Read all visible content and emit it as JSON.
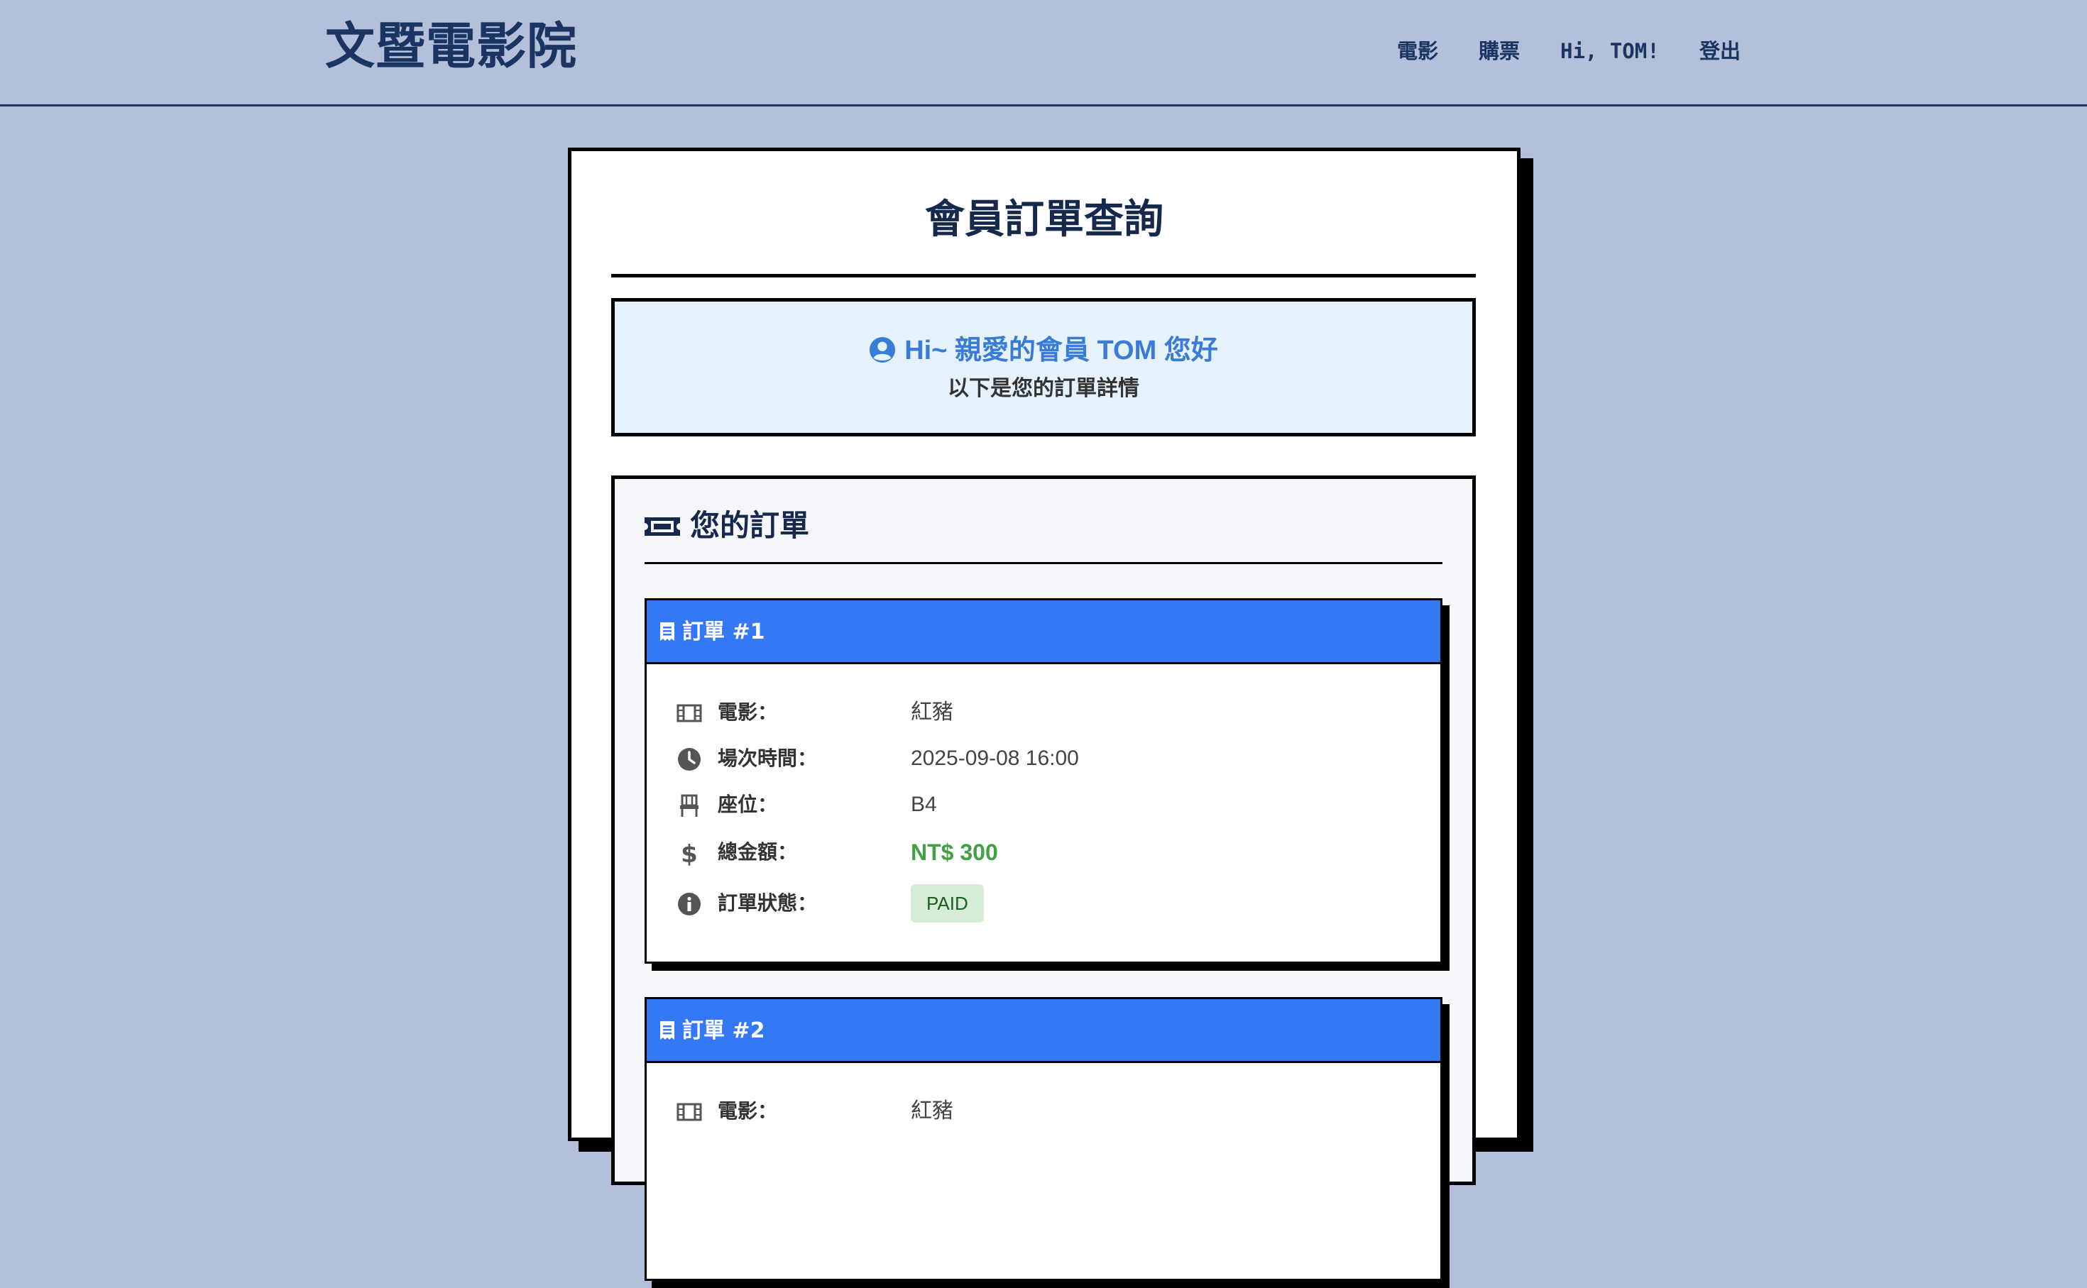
{
  "header": {
    "brand": "文暨電影院",
    "nav": {
      "movies": "電影",
      "tickets": "購票",
      "greeting": "Hi, TOM!",
      "logout": "登出"
    }
  },
  "page": {
    "title": "會員訂單查詢",
    "welcome": {
      "greeting": "Hi~ 親愛的會員 TOM 您好",
      "subtitle": "以下是您的訂單詳情"
    },
    "orders_heading": "您的訂單"
  },
  "labels": {
    "movie": "電影：",
    "showtime": "場次時間：",
    "seat": "座位：",
    "total": "總金額：",
    "status": "訂單狀態："
  },
  "orders": [
    {
      "title": "訂單 #1",
      "movie": "紅豬",
      "showtime": "2025-09-08 16:00",
      "seat": "B4",
      "total": "NT$ 300",
      "status": "PAID"
    },
    {
      "title": "訂單 #2",
      "movie": "紅豬"
    }
  ],
  "colors": {
    "background": "#b4c0d9",
    "accent": "#3578f4",
    "price": "#43a047",
    "welcome_bg": "#e5f1fb"
  }
}
